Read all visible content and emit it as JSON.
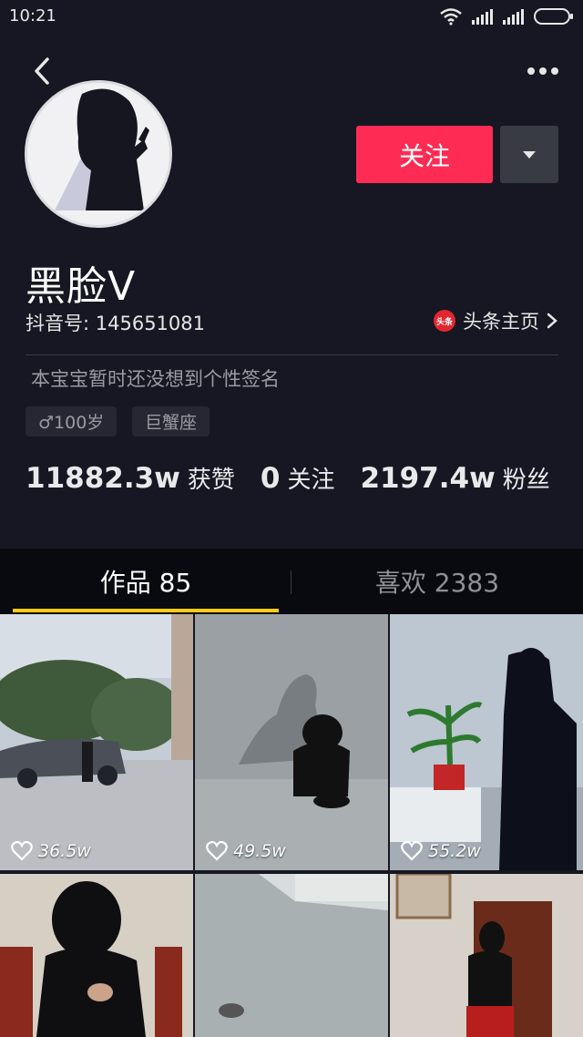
{
  "status_bar": {
    "time": "10:21"
  },
  "profile": {
    "nickname": "黑脸V",
    "douyin_id": "抖音号: 145651081",
    "toutiao_label": "头条主页",
    "toutiao_badge": "头条",
    "signature": "本宝宝暂时还没想到个性签名",
    "tags": [
      "♂100岁",
      "巨蟹座"
    ],
    "follow_label": "关注"
  },
  "stats": [
    {
      "num": "11882.3w",
      "label": "获赞"
    },
    {
      "num": "0",
      "label": "关注"
    },
    {
      "num": "2197.4w",
      "label": "粉丝"
    }
  ],
  "tabs": [
    {
      "label": "作品 85",
      "active": true
    },
    {
      "label": "喜欢 2383",
      "active": false
    }
  ],
  "videos": [
    {
      "likes": "36.5w"
    },
    {
      "likes": "49.5w"
    },
    {
      "likes": "55.2w"
    },
    {
      "likes": ""
    },
    {
      "likes": ""
    },
    {
      "likes": ""
    }
  ],
  "colors": {
    "accent": "#fe2c55",
    "tab_indicator": "#facc15",
    "background": "#161722"
  },
  "icons": [
    "back-icon",
    "more-icon",
    "wifi-icon",
    "signal-icon",
    "battery-icon",
    "caret-down-icon",
    "chevron-right-icon",
    "heart-icon"
  ]
}
